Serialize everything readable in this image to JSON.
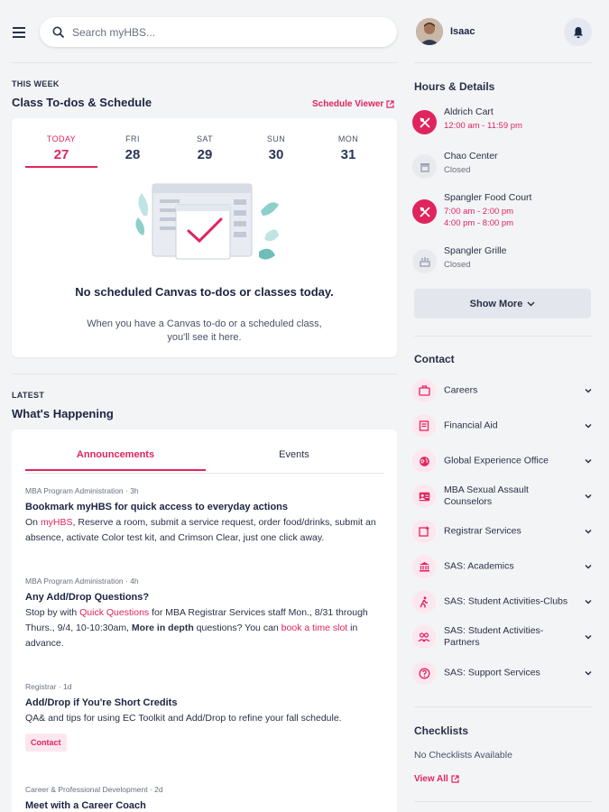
{
  "search": {
    "placeholder": "Search myHBS..."
  },
  "user": {
    "name": "Isaac"
  },
  "this_week": {
    "eyebrow": "THIS WEEK",
    "title": "Class To-dos & Schedule",
    "viewer_link": "Schedule Viewer",
    "days": [
      {
        "name": "TODAY",
        "num": "27"
      },
      {
        "name": "FRI",
        "num": "28"
      },
      {
        "name": "SAT",
        "num": "29"
      },
      {
        "name": "SUN",
        "num": "30"
      },
      {
        "name": "MON",
        "num": "31"
      }
    ],
    "empty_title": "No scheduled Canvas to-dos or classes today.",
    "empty_desc": "When you have a Canvas to-do or a scheduled class, you'll see it here."
  },
  "latest": {
    "eyebrow": "LATEST",
    "title": "What's Happening",
    "tabs": [
      "Announcements",
      "Events"
    ],
    "announcements": [
      {
        "meta": "MBA Program Administration · 3h",
        "title": "Bookmark myHBS for quick access to everyday actions",
        "body_1": "On ",
        "body_link": "myHBS",
        "body_2": ", Reserve a room, submit a service request, order food/drinks, submit an absence, activate Color test kit, and Crimson Clear, just one click away."
      },
      {
        "meta": "MBA Program Administration · 4h",
        "title": "Any Add/Drop Questions?",
        "body_1": "Stop by with ",
        "body_link_1": "Quick Questions",
        "body_2": " for MBA Registrar Services staff  Mon., 8/31 through Thurs., 9/4,  10-10:30am, ",
        "body_bold": "More in depth",
        "body_3": " questions? You can ",
        "body_link_2": "book a time slot",
        "body_4": " in advance."
      },
      {
        "meta": "Registrar · 1d",
        "title": "Add/Drop if You're Short Credits",
        "body": "QA& and tips for using EC Toolkit and Add/Drop to refine your fall schedule.",
        "chip": "Contact"
      },
      {
        "meta": "Career & Professional Development · 2d",
        "title": "Meet with a Career Coach"
      }
    ]
  },
  "hours": {
    "title": "Hours & Details",
    "venues": [
      {
        "name": "Aldrich Cart",
        "hours": "12:00 am - 11:59 pm",
        "status": "open"
      },
      {
        "name": "Chao Center",
        "hours": "Closed",
        "status": "closed"
      },
      {
        "name": "Spangler Food Court",
        "hours": "7:00 am - 2:00 pm",
        "hours_2": "4:00 pm - 8:00 pm",
        "status": "open"
      },
      {
        "name": "Spangler Grille",
        "hours": "Closed",
        "status": "closed"
      }
    ],
    "show_more": "Show More"
  },
  "contact": {
    "title": "Contact",
    "items": [
      {
        "label": "Careers",
        "icon": "briefcase-icon"
      },
      {
        "label": "Financial Aid",
        "icon": "document-icon"
      },
      {
        "label": "Global Experience Office",
        "icon": "globe-icon"
      },
      {
        "label": "MBA Sexual Assault Counselors",
        "icon": "id-card-icon"
      },
      {
        "label": "Registrar Services",
        "icon": "calendar-add-icon"
      },
      {
        "label": "SAS: Academics",
        "icon": "institution-icon"
      },
      {
        "label": "SAS: Student Activities-Clubs",
        "icon": "person-run-icon"
      },
      {
        "label": "SAS: Student Activities-Partners",
        "icon": "people-icon"
      },
      {
        "label": "SAS: Support Services",
        "icon": "help-icon"
      }
    ]
  },
  "checklists": {
    "title": "Checklists",
    "empty": "No Checklists Available",
    "view_all": "View All"
  },
  "colors": {
    "accent": "#e0245e",
    "text": "#1c2540",
    "background": "#f3f4f6"
  }
}
